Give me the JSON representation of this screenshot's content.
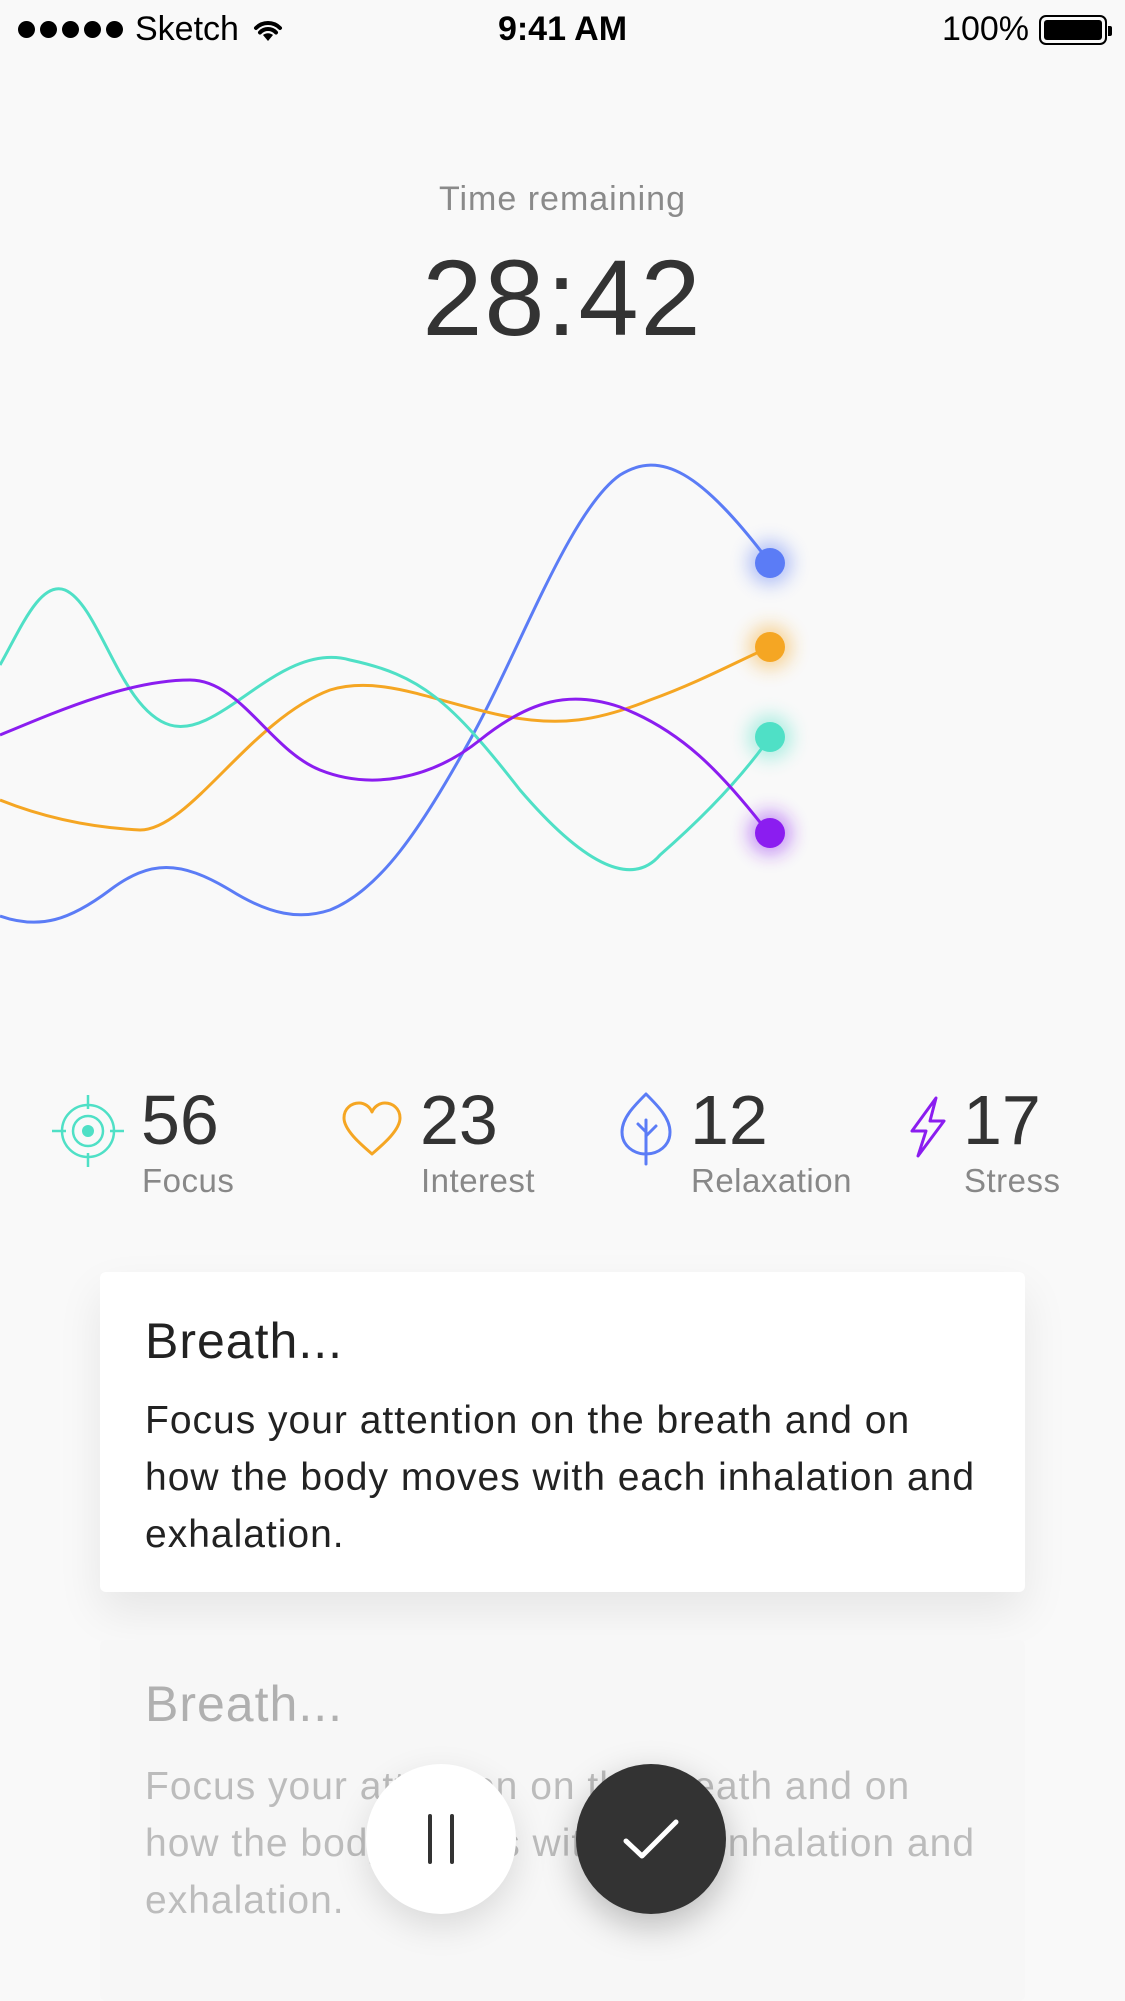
{
  "status_bar": {
    "carrier": "Sketch",
    "time": "9:41 AM",
    "battery": "100%",
    "signal_icon": "signal-dots-icon",
    "wifi_icon": "wifi-icon",
    "battery_icon": "battery-icon"
  },
  "timer": {
    "label": "Time remaining",
    "value": "28:42"
  },
  "metrics": [
    {
      "value": "56",
      "label": "Focus",
      "icon": "target-icon",
      "color": "#4fe0c6"
    },
    {
      "value": "23",
      "label": "Interest",
      "icon": "heart-icon",
      "color": "#f5a623"
    },
    {
      "value": "12",
      "label": "Relaxation",
      "icon": "leaf-icon",
      "color": "#5b7cf6"
    },
    {
      "value": "17",
      "label": "Stress",
      "icon": "lightning-icon",
      "color": "#8b1df0"
    }
  ],
  "chart_data": {
    "type": "line",
    "series": [
      {
        "metric": "Relaxation",
        "color": "#5b7cf6"
      },
      {
        "metric": "Interest",
        "color": "#f5a623"
      },
      {
        "metric": "Focus",
        "color": "#4fe0c6"
      },
      {
        "metric": "Stress",
        "color": "#8b1df0"
      }
    ]
  },
  "cards": [
    {
      "title": "Breath...",
      "body": "Focus your attention on the breath and on how the body moves with each inhalation and exhalation."
    },
    {
      "title": "Breath...",
      "body": "Focus your attention on the breath and on how the body moves with each inhalation and exhalation."
    }
  ],
  "controls": {
    "pause_icon": "pause-icon",
    "done_icon": "checkmark-icon"
  }
}
